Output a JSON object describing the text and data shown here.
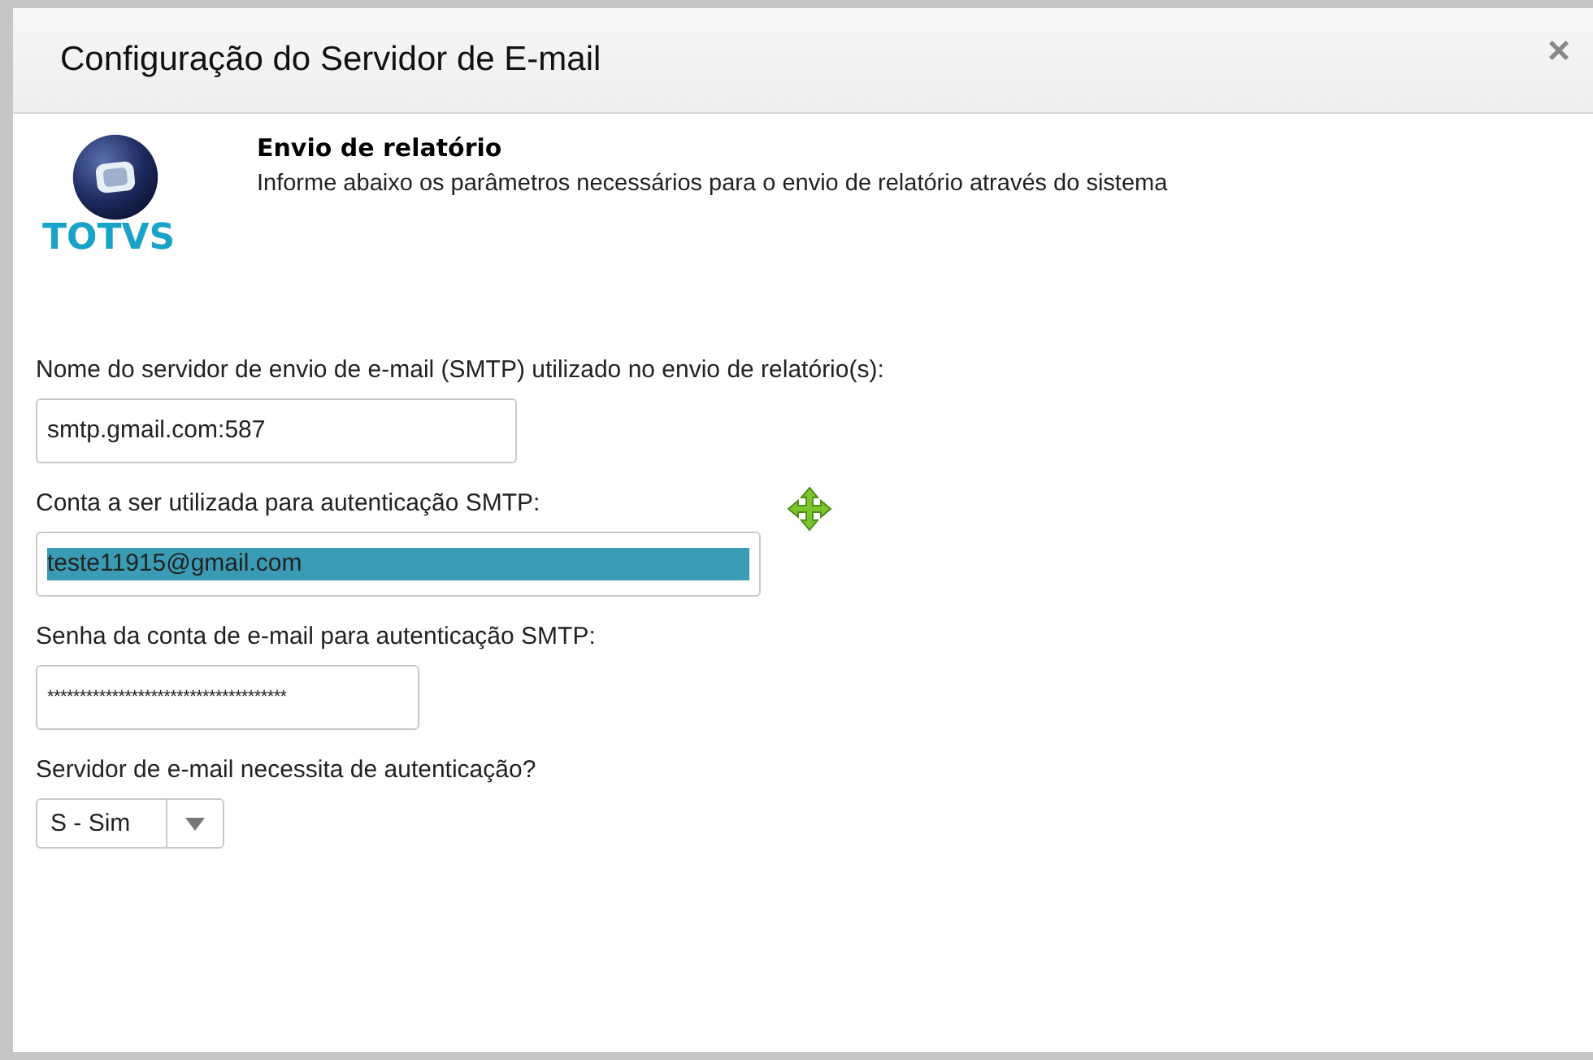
{
  "dialog": {
    "title": "Configuração do Servidor de E-mail",
    "close": "×"
  },
  "logo": {
    "text": "TOTVS"
  },
  "intro": {
    "heading": "Envio de relatório",
    "description": "Informe abaixo os parâmetros necessários para o envio de relatório através do sistema"
  },
  "fields": [
    {
      "kind": "text",
      "label": "Nome do servidor de envio de e-mail (SMTP) utilizado no envio de relatório(s):",
      "value": "smtp.gmail.com:587"
    },
    {
      "kind": "text",
      "label": "Conta a ser utilizada para autenticação SMTP:",
      "value": "teste11915@gmail.com",
      "text_selected": true
    },
    {
      "kind": "password",
      "label": "Senha da conta de e-mail para autenticação SMTP:",
      "value": "*************************************"
    },
    {
      "kind": "select",
      "label": "Servidor de e-mail necessita de autenticação?",
      "value": "S - Sim"
    }
  ]
}
